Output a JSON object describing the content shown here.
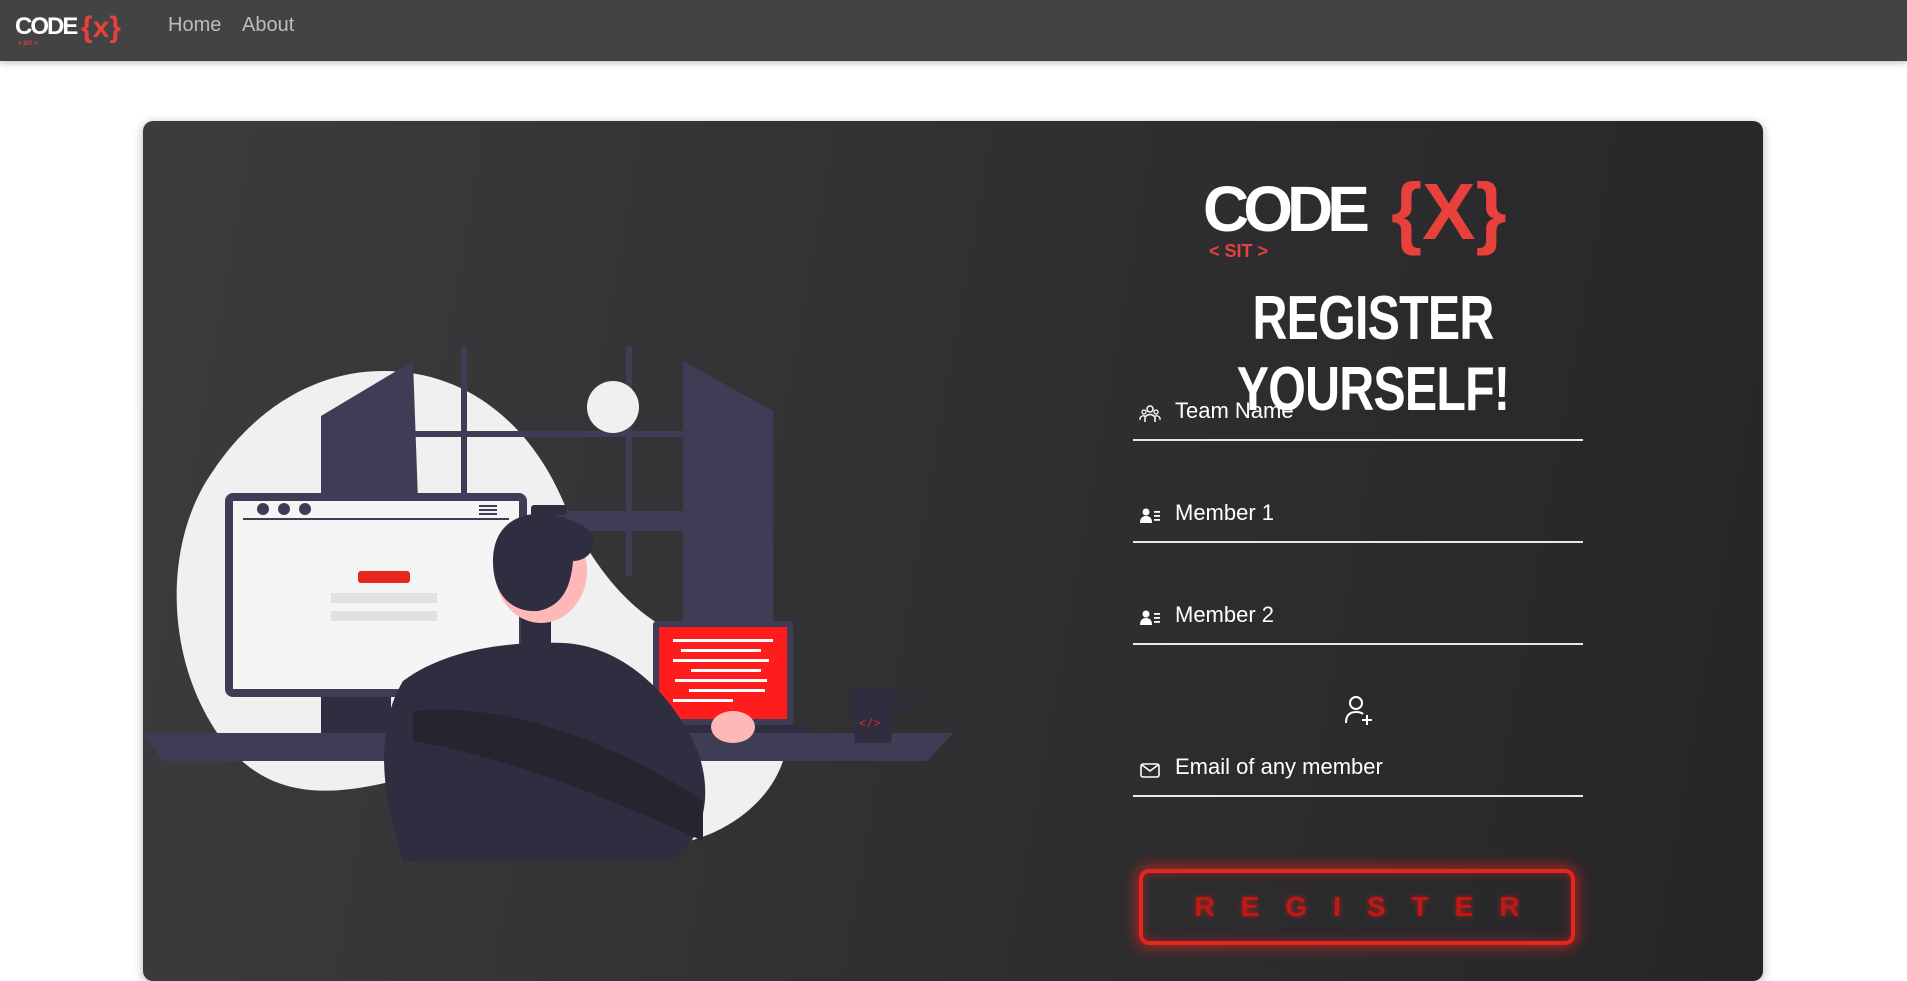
{
  "nav": {
    "logo_text": "CODE{X}",
    "logo_sub": "< SIT >",
    "links": [
      {
        "label": "Home"
      },
      {
        "label": "About"
      }
    ]
  },
  "brand": {
    "logo_text": "CODE{X}",
    "logo_sub": "< SIT >",
    "accent_color": "#e8241f"
  },
  "form": {
    "title": "REGISTER YOURSELF!",
    "fields": [
      {
        "placeholder": "Team Name",
        "icon": "team-icon"
      },
      {
        "placeholder": "Member 1",
        "icon": "member-card-icon"
      },
      {
        "placeholder": "Member 2",
        "icon": "member-card-icon"
      },
      {
        "placeholder": "Email of any member",
        "icon": "envelope-icon"
      }
    ],
    "add_member_icon": "user-plus-icon",
    "submit_label": "REGISTER"
  }
}
